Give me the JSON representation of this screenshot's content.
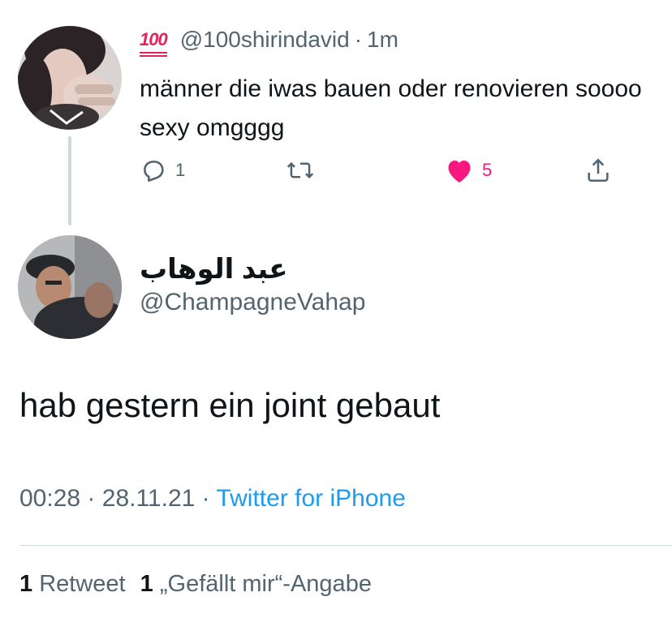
{
  "parent_tweet": {
    "emoji": "100",
    "handle": "@100shirindavid",
    "separator": "·",
    "time": "1m",
    "text": "männer die iwas bauen oder renovieren soooo sexy omgggg",
    "actions": {
      "reply_count": "1",
      "retweet_count": "",
      "like_count": "5",
      "like_color": "#f91880"
    }
  },
  "reply_tweet": {
    "display_name": "عبد الوهاب",
    "handle": "@ChampagneVahap",
    "text": "hab gestern ein joint gebaut",
    "time": "00:28",
    "date": "28.11.21",
    "separator": "·",
    "source": "Twitter for iPhone",
    "stats": {
      "retweets_count": "1",
      "retweets_label": "Retweet",
      "likes_count": "1",
      "likes_label": "„Gefällt mir“-Angabe"
    }
  },
  "colors": {
    "text_primary": "#0f1419",
    "text_secondary": "#536471",
    "link": "#1d9bf0",
    "divider": "#cfd9de"
  },
  "icons": [
    "reply-icon",
    "retweet-icon",
    "heart-icon",
    "share-icon",
    "hundred-points-emoji"
  ]
}
